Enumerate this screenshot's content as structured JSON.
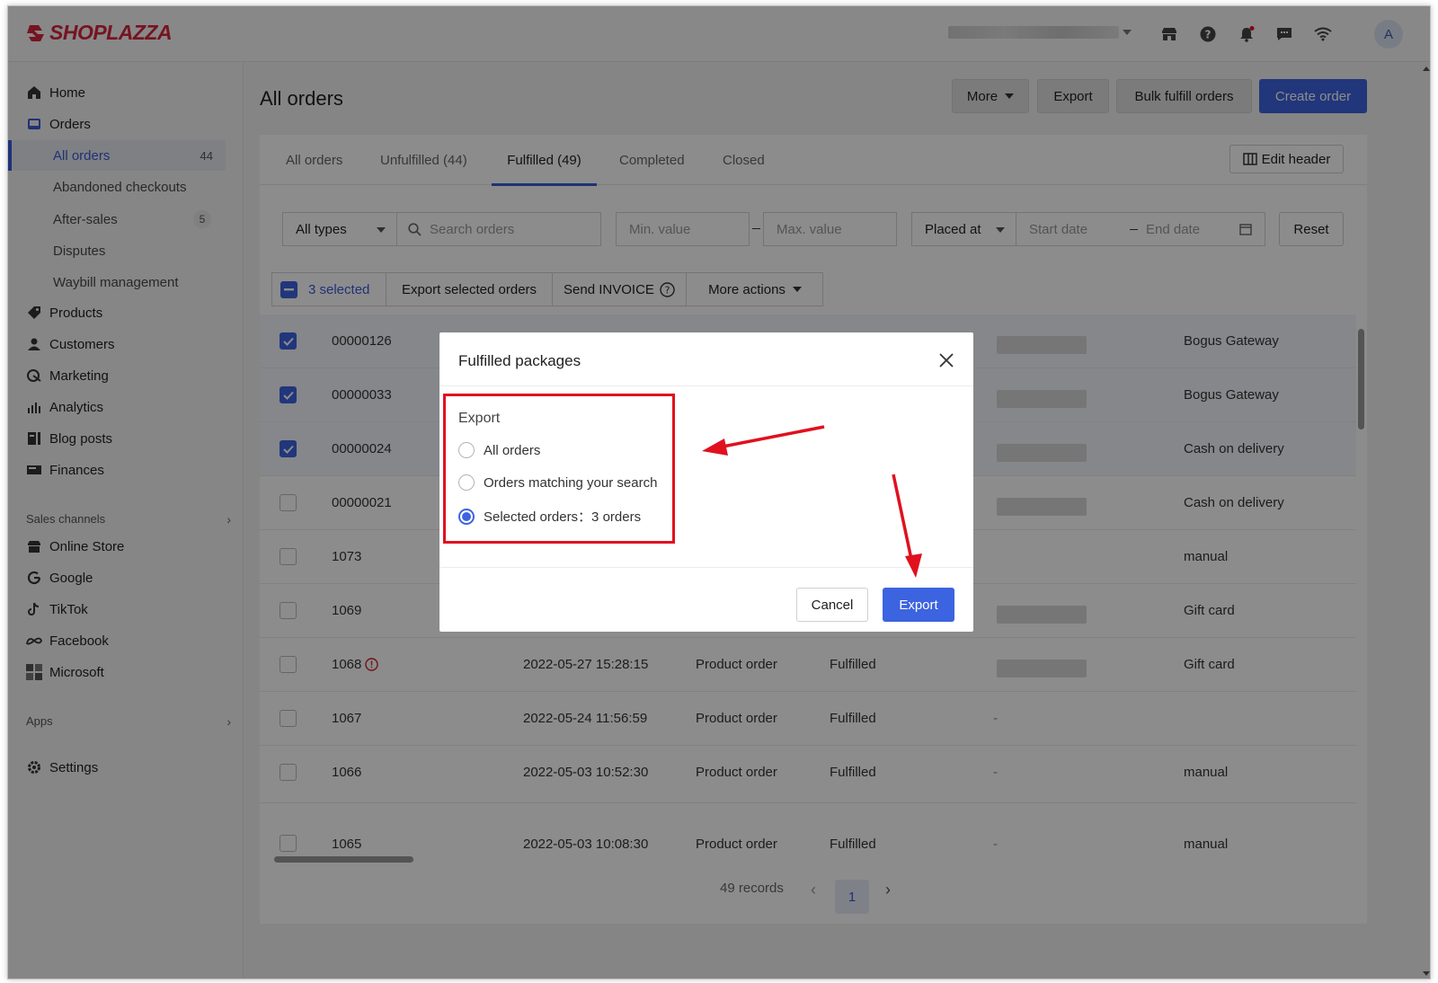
{
  "brand": {
    "name": "SHOPLAZZA",
    "color": "#d7263d",
    "accent": "#3c63e0"
  },
  "topbar": {
    "icons": [
      "store-icon",
      "help-icon",
      "bell-icon",
      "chat-icon",
      "wifi-icon"
    ],
    "avatar_letter": "A"
  },
  "sidebar": {
    "items": [
      {
        "label": "Home",
        "icon": "home-icon"
      },
      {
        "label": "Orders",
        "icon": "orders-icon"
      }
    ],
    "orders_sub": [
      {
        "label": "All orders",
        "count": "44"
      },
      {
        "label": "Abandoned checkouts"
      },
      {
        "label": "After-sales",
        "count": "5"
      },
      {
        "label": "Disputes"
      },
      {
        "label": "Waybill management"
      }
    ],
    "items2": [
      {
        "label": "Products",
        "icon": "tag-icon"
      },
      {
        "label": "Customers",
        "icon": "person-icon"
      },
      {
        "label": "Marketing",
        "icon": "marketing-icon"
      },
      {
        "label": "Analytics",
        "icon": "analytics-icon"
      },
      {
        "label": "Blog posts",
        "icon": "blog-icon"
      },
      {
        "label": "Finances",
        "icon": "finances-icon"
      }
    ],
    "sales_channels_label": "Sales channels",
    "channels": [
      {
        "label": "Online Store",
        "icon": "store-icon"
      },
      {
        "label": "Google",
        "icon": "google-icon"
      },
      {
        "label": "TikTok",
        "icon": "tiktok-icon"
      },
      {
        "label": "Facebook",
        "icon": "meta-icon"
      },
      {
        "label": "Microsoft",
        "icon": "microsoft-icon"
      }
    ],
    "apps_label": "Apps",
    "settings_label": "Settings"
  },
  "header": {
    "title": "All orders",
    "more_label": "More",
    "export_label": "Export",
    "bulk_label": "Bulk fulfill orders",
    "create_label": "Create order"
  },
  "tabs": [
    {
      "label": "All orders"
    },
    {
      "label": "Unfulfilled  (44)"
    },
    {
      "label": "Fulfilled  (49)"
    },
    {
      "label": "Completed"
    },
    {
      "label": "Closed"
    }
  ],
  "edit_header_label": "Edit header",
  "filters": {
    "type_value": "All types",
    "search_placeholder": "Search orders",
    "min_placeholder": "Min. value",
    "max_placeholder": "Max. value",
    "date_field": "Placed at",
    "start_placeholder": "Start date",
    "end_placeholder": "End date",
    "reset_label": "Reset"
  },
  "bulk": {
    "selected_label": "3 selected",
    "export_selected_label": "Export selected orders",
    "send_invoice_label": "Send INVOICE",
    "more_actions_label": "More actions"
  },
  "orders": [
    {
      "id": "00000126",
      "date": "",
      "type": "",
      "status": "",
      "payment": "Bogus Gateway",
      "checked": true
    },
    {
      "id": "00000033",
      "date": "",
      "type": "",
      "status": "",
      "payment": "Bogus Gateway",
      "checked": true
    },
    {
      "id": "00000024",
      "date": "",
      "type": "",
      "status": "",
      "payment": "Cash on delivery",
      "checked": true
    },
    {
      "id": "00000021",
      "date": "",
      "type": "",
      "status": "",
      "payment": "Cash on delivery",
      "checked": false
    },
    {
      "id": "1073",
      "date": "",
      "type": "",
      "status": "",
      "payment": "manual",
      "checked": false
    },
    {
      "id": "1069",
      "date": "",
      "type": "",
      "status": "",
      "payment": "Gift card",
      "checked": false
    },
    {
      "id": "1068",
      "date": "2022-05-27 15:28:15",
      "type": "Product order",
      "status": "Fulfilled",
      "payment": "Gift card",
      "checked": false,
      "warning": true
    },
    {
      "id": "1067",
      "date": "2022-05-24 11:56:59",
      "type": "Product order",
      "status": "Fulfilled",
      "dash": "-",
      "payment": "",
      "checked": false
    },
    {
      "id": "1066",
      "date": "2022-05-03 10:52:30",
      "type": "Product order",
      "status": "Fulfilled",
      "dash": "-",
      "payment": "manual",
      "checked": false
    },
    {
      "id": "1065",
      "date": "2022-05-03 10:08:30",
      "type": "Product order",
      "status": "Fulfilled",
      "dash": "-",
      "payment": "manual",
      "checked": false
    }
  ],
  "pagination": {
    "records": "49 records",
    "current_page": "1"
  },
  "modal": {
    "title": "Fulfilled packages",
    "section_label": "Export",
    "options": [
      {
        "label": "All orders",
        "selected": false
      },
      {
        "label": "Orders matching your search",
        "selected": false
      },
      {
        "label": "Selected orders：3 orders",
        "selected": true
      }
    ],
    "cancel_label": "Cancel",
    "export_label": "Export"
  }
}
